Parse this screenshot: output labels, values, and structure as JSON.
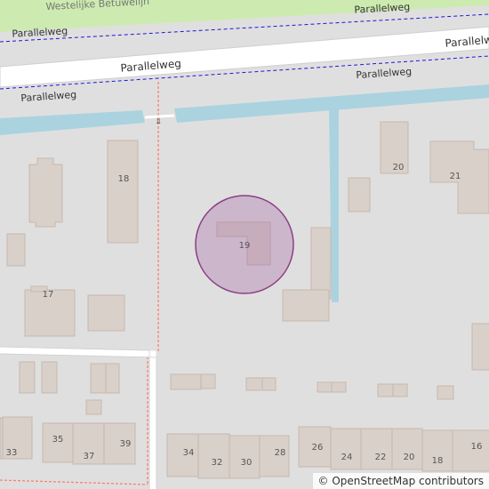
{
  "map": {
    "streets": {
      "top_label": "Westelijke Betuwelijn",
      "parallelweg_labels": [
        "Parallelweg",
        "Parallelweg",
        "Parallelweg",
        "Parallelweg",
        "Parallelweg"
      ]
    },
    "highlight": {
      "house_number": "19",
      "color": "#a05a9e"
    },
    "house_numbers": [
      "18",
      "20",
      "21",
      "17",
      "33",
      "35",
      "37",
      "39",
      "34",
      "32",
      "30",
      "28",
      "26",
      "24",
      "22",
      "20",
      "18",
      "16"
    ],
    "colors": {
      "background": "#e0dfdf",
      "building": "#d9d0c9",
      "building_stroke": "#c5b9b0",
      "water": "#aad3df",
      "road": "#ffffff",
      "rail_grass": "#cdebb0",
      "path_dashed": "#fa8072",
      "boundary_blue": "#1a1ad4"
    },
    "attribution": "© OpenStreetMap contributors"
  }
}
